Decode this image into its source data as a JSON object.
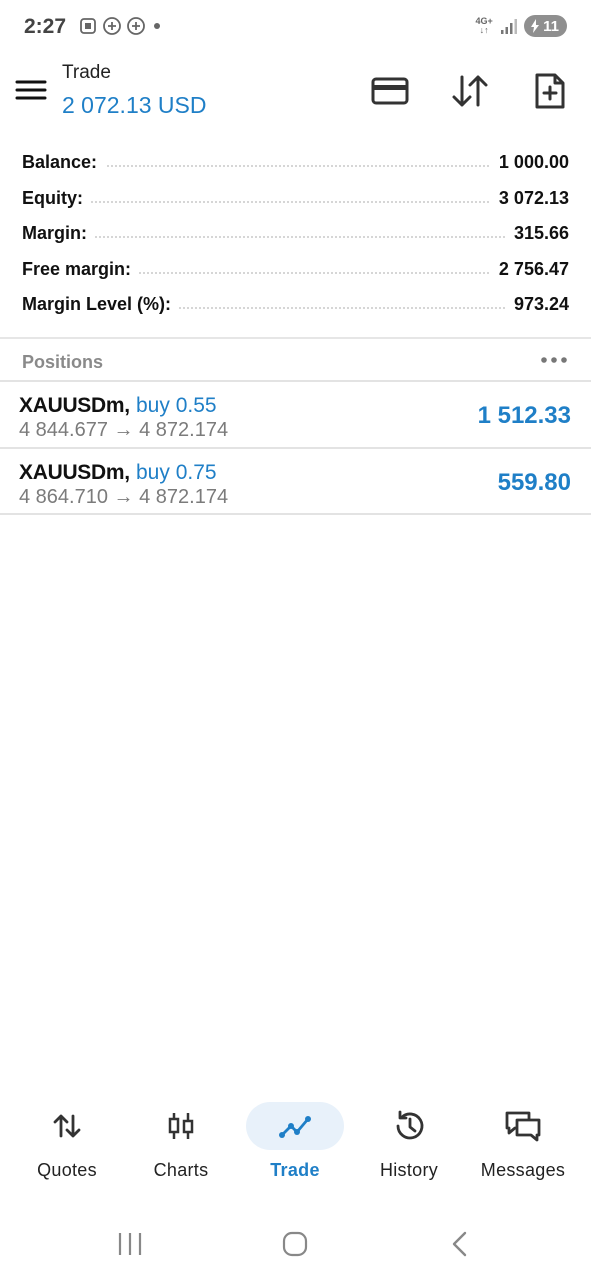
{
  "status_bar": {
    "time": "2:27",
    "network_top": "4G+",
    "battery": "11"
  },
  "header": {
    "title": "Trade",
    "balance": "2 072.13 USD"
  },
  "summary": [
    {
      "label": "Balance:",
      "value": "1 000.00"
    },
    {
      "label": "Equity:",
      "value": "3 072.13"
    },
    {
      "label": "Margin:",
      "value": "315.66"
    },
    {
      "label": "Free margin:",
      "value": "2 756.47"
    },
    {
      "label": "Margin Level (%):",
      "value": "973.24"
    }
  ],
  "positions": {
    "title": "Positions",
    "items": [
      {
        "symbol": "XAUUSDm,",
        "direction": "buy 0.55",
        "prices": "4 844.677 → 4 872.174",
        "profit": "1 512.33"
      },
      {
        "symbol": "XAUUSDm,",
        "direction": "buy 0.75",
        "prices": "4 864.710 → 4 872.174",
        "profit": "559.80"
      }
    ]
  },
  "bottom_nav": [
    {
      "label": "Quotes",
      "icon": "quotes-arrows-icon"
    },
    {
      "label": "Charts",
      "icon": "candlestick-icon"
    },
    {
      "label": "Trade",
      "icon": "trade-line-icon",
      "active": true
    },
    {
      "label": "History",
      "icon": "history-clock-icon"
    },
    {
      "label": "Messages",
      "icon": "chat-bubbles-icon"
    }
  ],
  "colors": {
    "accent": "#1f7fc7",
    "active_nav_bg": "#e8f1fa",
    "muted_text": "#7b7b7b"
  }
}
